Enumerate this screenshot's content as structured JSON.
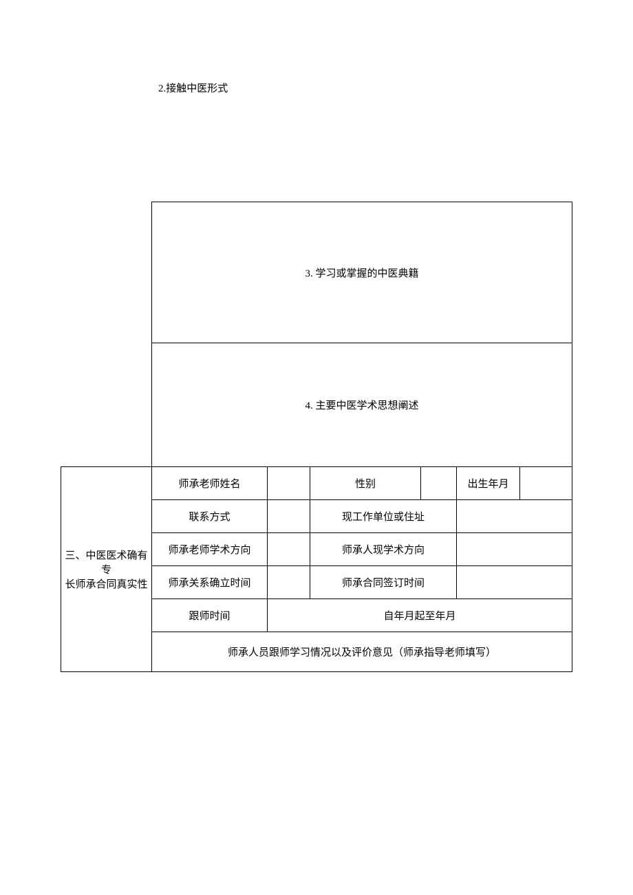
{
  "floating": {
    "item2": "2.接触中医形式"
  },
  "section2": {
    "item3": "3. 学习或掌握的中医典籍",
    "item4": "4. 主要中医学术思想阐述"
  },
  "section3": {
    "title_line1": "三、中医医术确有专",
    "title_line2": "长师承合同真实性",
    "row1": {
      "label1": "师承老师姓名",
      "value1": "",
      "label2": "性别",
      "value2": "",
      "label3": "出生年月",
      "value3": ""
    },
    "row2": {
      "label1": "联系方式",
      "value1": "",
      "label2": "现工作单位或住址",
      "value2": ""
    },
    "row3": {
      "label1": "师承老师学术方向",
      "value1": "",
      "label2": "师承人现学术方向",
      "value2": ""
    },
    "row4": {
      "label1": "师承关系确立时间",
      "value1": "",
      "label2": "师承合同签订时间",
      "value2": ""
    },
    "row5": {
      "label1": "跟师时间",
      "value1": "自年月起至年月"
    },
    "row6": {
      "header": "师承人员跟师学习情况以及评价意见（师承指导老师填写）"
    }
  }
}
